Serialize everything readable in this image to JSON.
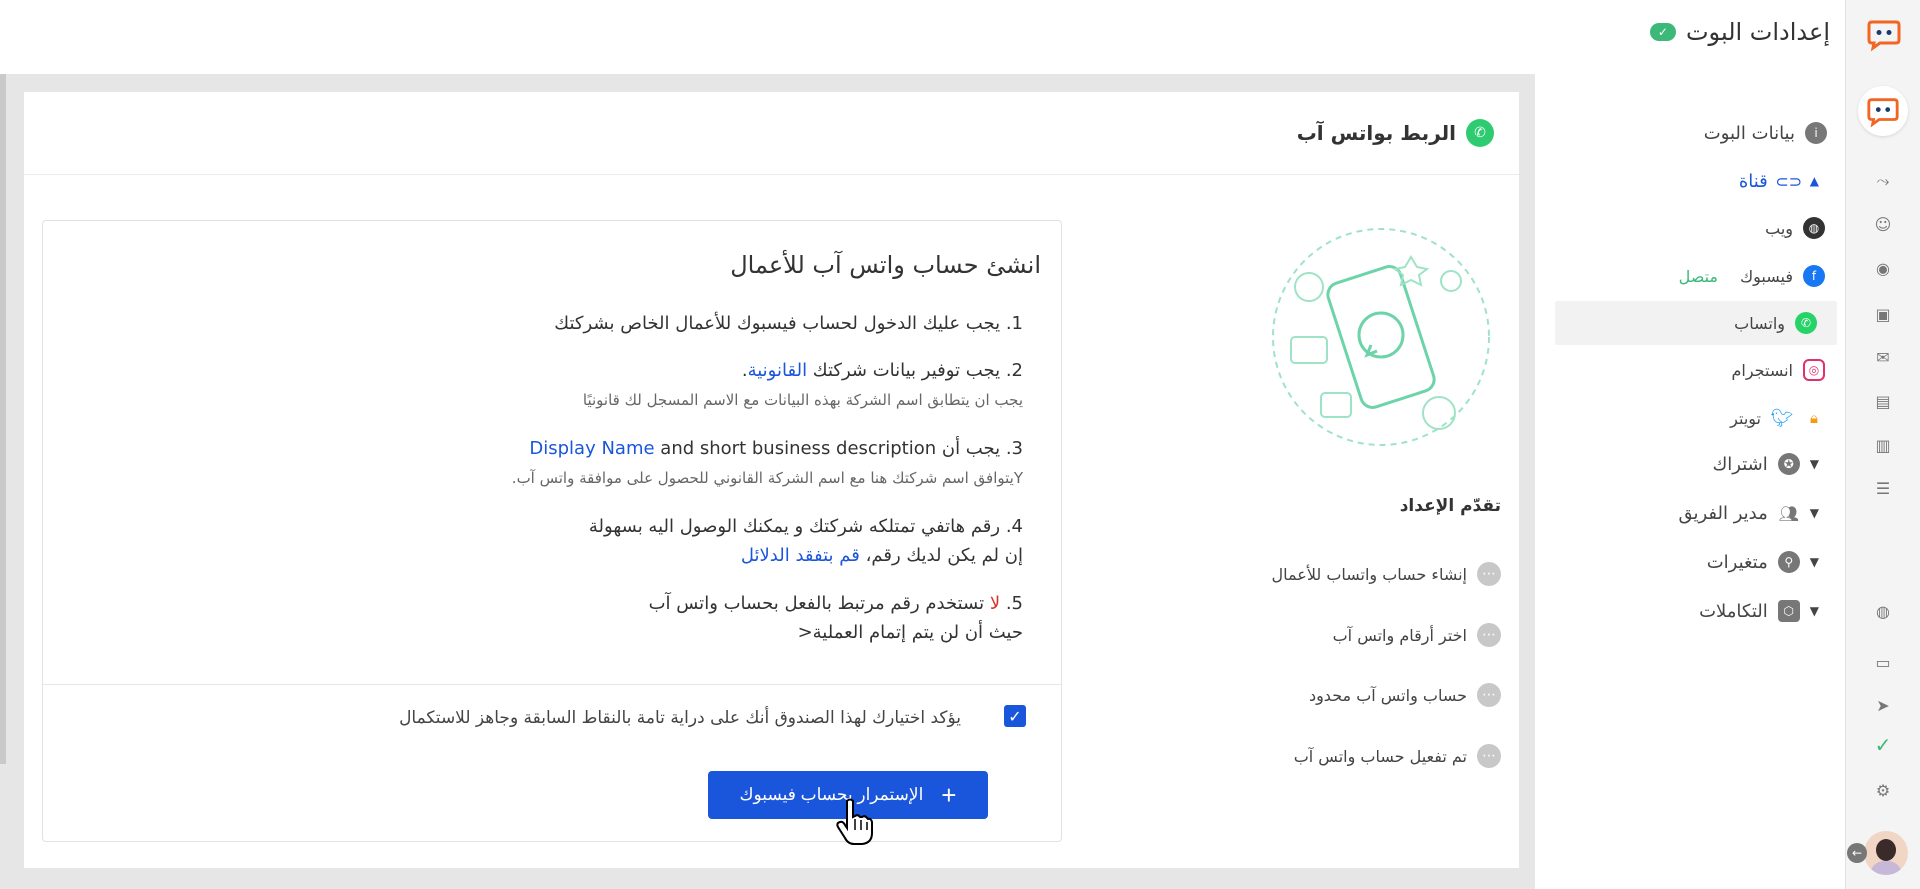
{
  "header": {
    "title": "إعدادات البوت"
  },
  "sidebar": {
    "items": [
      {
        "label": "بيانات البوت",
        "color": "#777777"
      },
      {
        "label": "قناة",
        "color": "#1a56db"
      },
      {
        "label": "ويب",
        "color": "#333333"
      },
      {
        "label": "فيسبوك",
        "status": "متصل",
        "color": "#1877f2"
      },
      {
        "label": "واتساب",
        "color": "#25d366"
      },
      {
        "label": "انستجرام",
        "color": "#e1306c"
      },
      {
        "label": "تويتر",
        "color": "#1da1f2"
      },
      {
        "label": "اشتراك",
        "color": "#777777"
      },
      {
        "label": "مدير الفريق",
        "color": "#777777"
      },
      {
        "label": "متغيرات",
        "color": "#777777"
      },
      {
        "label": "التكاملات",
        "color": "#777777"
      }
    ]
  },
  "card": {
    "title": "الربط بواتس آب",
    "progress": {
      "title": "تقدّم الإعداد",
      "steps": [
        "إنشاء حساب واتساب للأعمال",
        "اختر أرقام واتس آب",
        "حساب واتس آب محدود",
        "تم تفعيل حساب واتس آب"
      ]
    },
    "instructions": {
      "title": "انشئ حساب واتس آب للأعمال",
      "s1": "1. يجب عليك الدخول لحساب فيسبوك للأعمال الخاص بشركتك",
      "s2a": "2. يجب توفير بيانات شركتك ",
      "s2link": "القانونية",
      "s2b": ".",
      "s2note": "يجب ان يتطابق اسم الشركة بهذه البيانات مع الاسم المسجل لك قانونيًا",
      "s3a": "3. يجب أن ",
      "s3link": "Display Name",
      "s3b": " and short business description",
      "s3note": "Yيتوافق اسم شركتك هنا مع اسم الشركة القانوني للحصول على موافقة واتس آب.",
      "s4": "4. رقم هاتفي تمتلكه شركتك و يمكنك الوصول اليه بسهولة",
      "s4b": "إن لم يكن لديك رقم، ",
      "s4link": "قم بتفقد الدلائل",
      "s5a": "5. ",
      "s5neg": "لا",
      "s5b": " تستخدم رقم مرتبط بالفعل بحساب واتس آب",
      "s5c": "حيث أن لن يتم إتمام العملية<",
      "confirm": "يؤكد اختيارك لهذا الصندوق أنك على دراية تامة بالنقاط السابقة وجاهز للاستكمال",
      "button": "الإستمرار بحساب فيسبوك"
    }
  },
  "colors": {
    "accent": "#1a56db",
    "brand": "#f26522",
    "success": "#3cb878",
    "whatsapp": "#2ecc71"
  }
}
